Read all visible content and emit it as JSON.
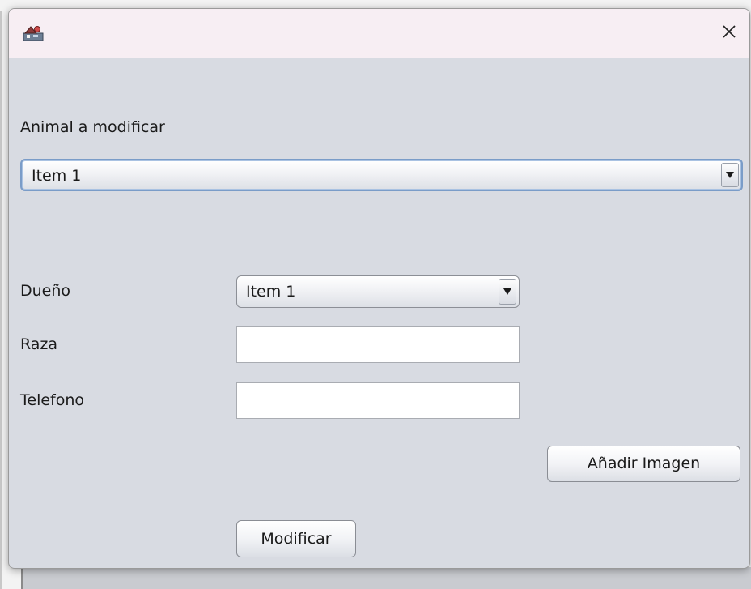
{
  "window": {
    "app_icon": "java-app-icon",
    "close_icon": "close-icon"
  },
  "form": {
    "animal_label": "Animal a modificar",
    "animal_select": {
      "selected": "Item 1",
      "options": [
        "Item 1"
      ]
    },
    "owner_label": "Dueño",
    "owner_select": {
      "selected": "Item 1",
      "options": [
        "Item 1"
      ]
    },
    "breed_label": "Raza",
    "breed_value": "",
    "phone_label": "Telefono",
    "phone_value": "",
    "add_image_button": "Añadir Imagen",
    "modify_button": "Modificar"
  },
  "colors": {
    "titlebar": "#f7eef3",
    "panel": "#d8dbe2",
    "focus_border": "#7a9cc8"
  }
}
